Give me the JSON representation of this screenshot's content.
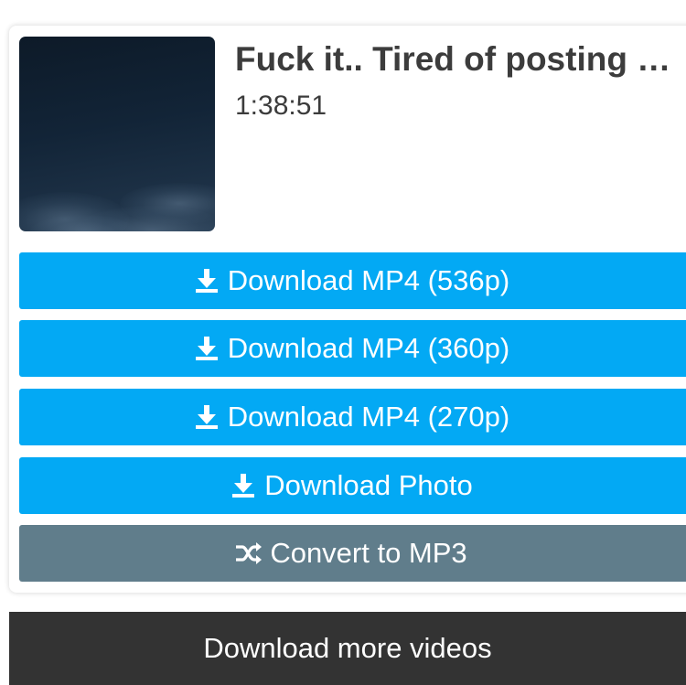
{
  "video": {
    "title": "Fuck it.. Tired of posting …",
    "duration": "1:38:51"
  },
  "buttons": {
    "mp4_536_label": "Download MP4 (536p)",
    "mp4_360_label": "Download MP4 (360p)",
    "mp4_270_label": "Download MP4 (270p)",
    "photo_label": "Download Photo",
    "convert_label": "Convert to MP3",
    "more_label": "Download more videos"
  },
  "icons": {
    "download": "download-icon",
    "convert": "shuffle-icon"
  },
  "colors": {
    "primary_button": "#03a9f4",
    "convert_button": "#607d8b",
    "more_bar": "#333333",
    "title_text": "#3c3c3c"
  }
}
